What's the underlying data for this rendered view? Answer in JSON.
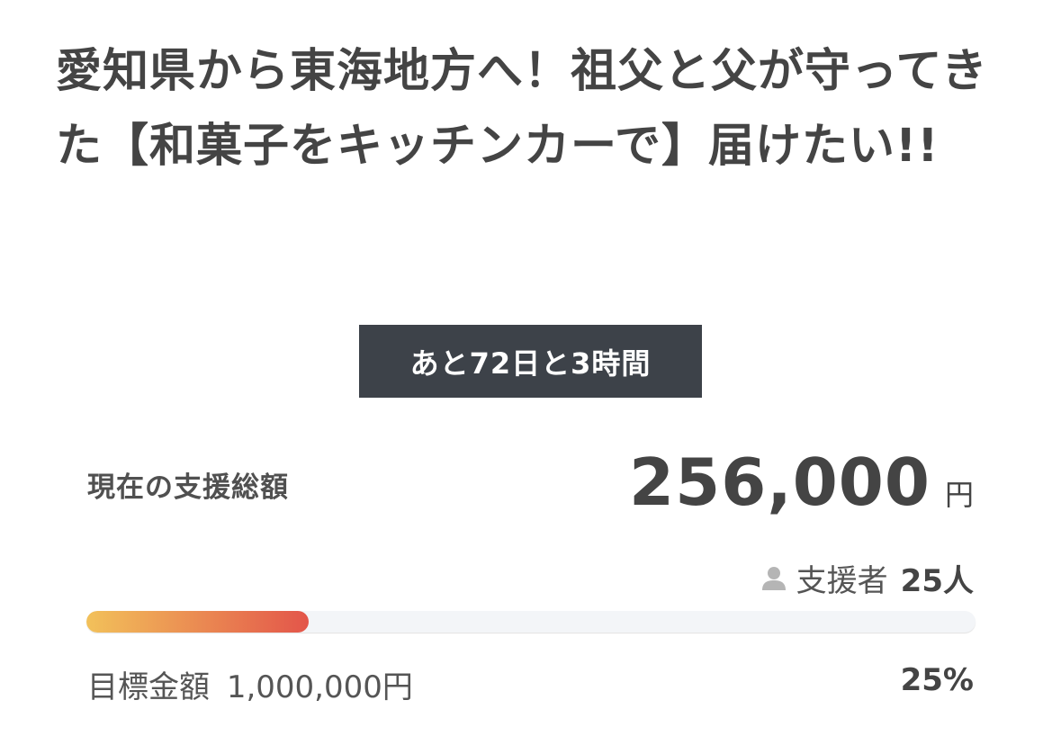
{
  "project": {
    "title": "愛知県から東海地方へ！祖父と父が守ってきた【和菓子をキッチンカーで】届けたい!!"
  },
  "countdown": {
    "text": "あと72日と3時間"
  },
  "funding": {
    "total_label": "現在の支援総額",
    "total_amount": "256,000",
    "currency_unit": "円",
    "supporters_icon": "person-icon",
    "supporters_label": "支援者",
    "supporters_count": "25人",
    "progress_fraction": 0.25,
    "progress_colors": {
      "start": "#f2c15a",
      "end": "#e3554a",
      "track": "#f3f5f8"
    },
    "goal_label": "目標金額",
    "goal_amount": "1,000,000円",
    "percent": "25%"
  },
  "colors": {
    "countdown_background": "#3d4249",
    "text": "#444444"
  }
}
